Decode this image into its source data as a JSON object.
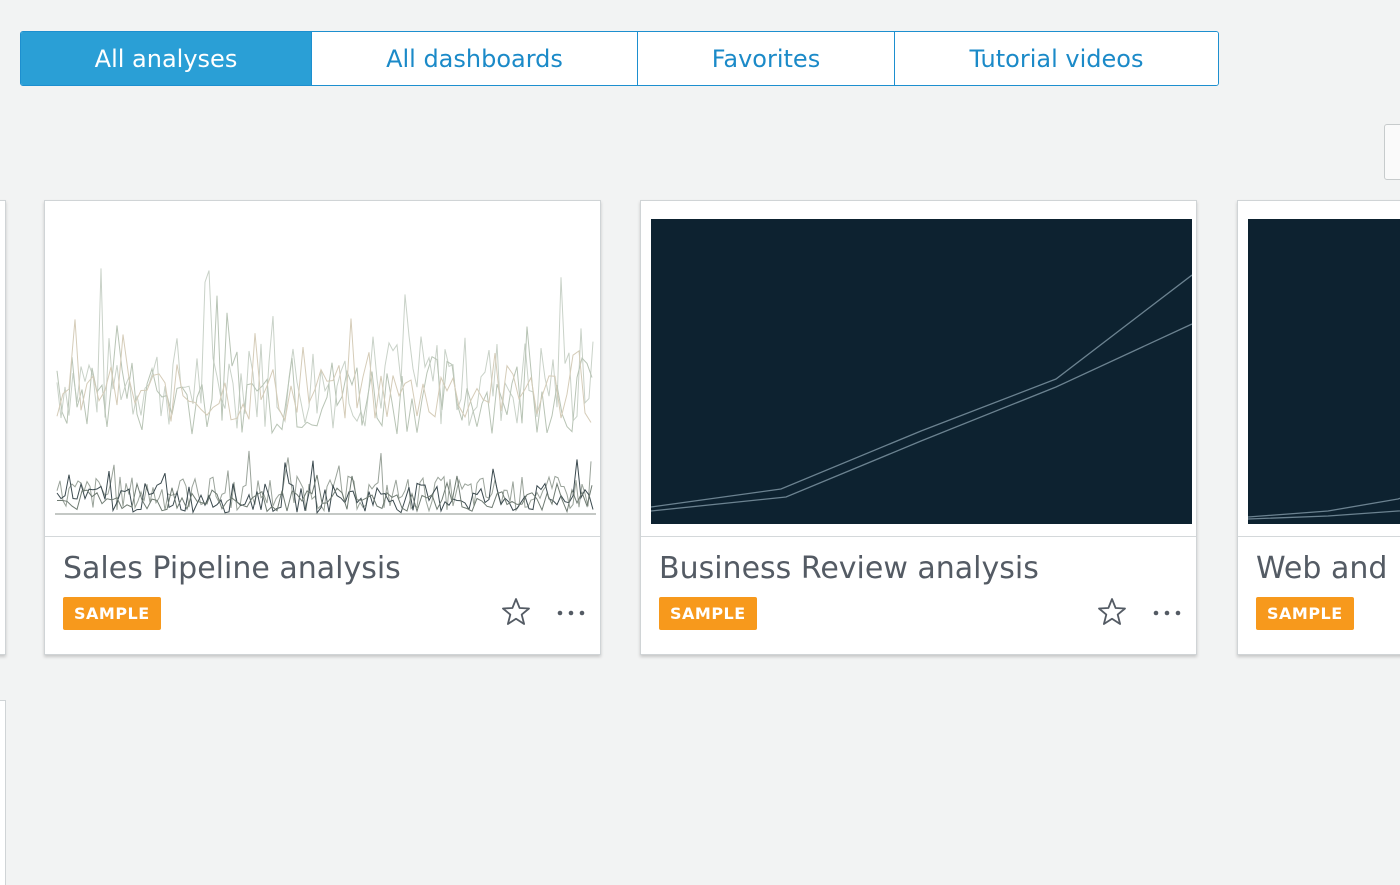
{
  "tabs": [
    {
      "label": "All analyses",
      "active": true
    },
    {
      "label": "All dashboards",
      "active": false
    },
    {
      "label": "Favorites",
      "active": false
    },
    {
      "label": "Tutorial videos",
      "active": false
    }
  ],
  "cards": [
    {
      "title": "Sales Pipeline analysis",
      "badge": "SAMPLE",
      "star_icon": "star-outline-icon",
      "more_icon": "ellipsis-icon"
    },
    {
      "title": "Business Review analysis",
      "badge": "SAMPLE",
      "star_icon": "star-outline-icon",
      "more_icon": "ellipsis-icon"
    },
    {
      "title": "Web and",
      "badge": "SAMPLE"
    }
  ],
  "colors": {
    "accent": "#2a9fd6",
    "badge": "#f7991c",
    "dark_thumb": "#0d2230",
    "background": "#f2f3f3"
  }
}
